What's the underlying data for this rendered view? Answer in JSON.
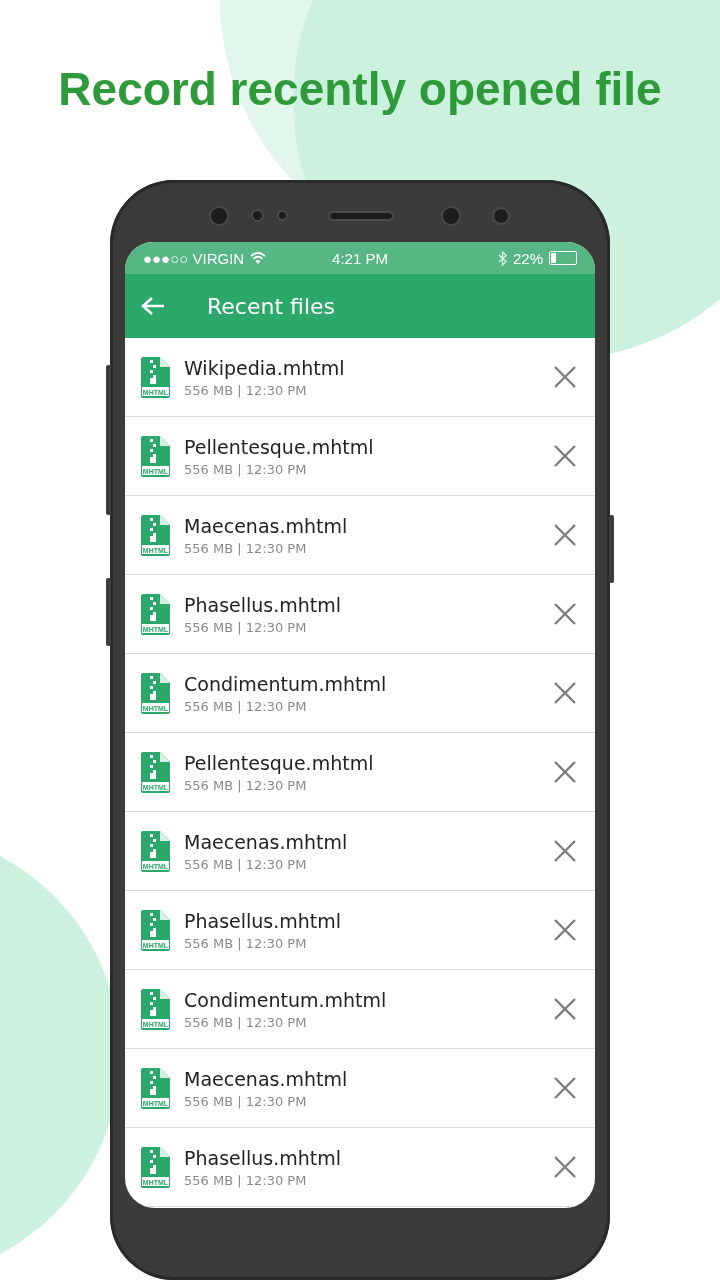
{
  "headline": "Record recently opened file",
  "status_bar": {
    "carrier": "●●●○○ VIRGIN",
    "time": "4:21 PM",
    "battery": "22%"
  },
  "app_bar": {
    "title": "Recent files"
  },
  "files": [
    {
      "name": "Wikipedia.mhtml",
      "meta": "556 MB | 12:30 PM",
      "type": "MHTML"
    },
    {
      "name": "Pellentesque.mhtml",
      "meta": "556 MB | 12:30 PM",
      "type": "MHTML"
    },
    {
      "name": "Maecenas.mhtml",
      "meta": "556 MB | 12:30 PM",
      "type": "MHTML"
    },
    {
      "name": "Phasellus.mhtml",
      "meta": "556 MB | 12:30 PM",
      "type": "MHTML"
    },
    {
      "name": "Condimentum.mhtml",
      "meta": "556 MB | 12:30 PM",
      "type": "MHTML"
    },
    {
      "name": "Pellentesque.mhtml",
      "meta": "556 MB | 12:30 PM",
      "type": "MHTML"
    },
    {
      "name": "Maecenas.mhtml",
      "meta": "556 MB | 12:30 PM",
      "type": "MHTML"
    },
    {
      "name": "Phasellus.mhtml",
      "meta": "556 MB | 12:30 PM",
      "type": "MHTML"
    },
    {
      "name": "Condimentum.mhtml",
      "meta": "556 MB | 12:30 PM",
      "type": "MHTML"
    },
    {
      "name": "Maecenas.mhtml",
      "meta": "556 MB | 12:30 PM",
      "type": "MHTML"
    },
    {
      "name": "Phasellus.mhtml",
      "meta": "556 MB | 12:30 PM",
      "type": "MHTML"
    }
  ]
}
